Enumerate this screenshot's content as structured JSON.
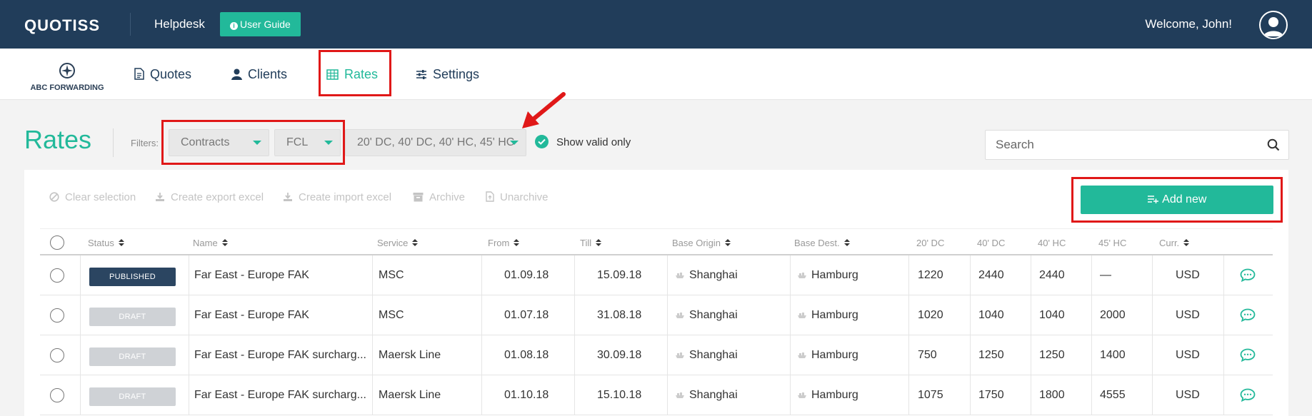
{
  "topbar": {
    "logo": "QUOTISS",
    "helpdesk": "Helpdesk",
    "user_guide": "User Guide",
    "welcome": "Welcome, John!"
  },
  "nav": {
    "brand": "ABC FORWARDING",
    "items": [
      {
        "label": "Quotes",
        "icon": "document-icon"
      },
      {
        "label": "Clients",
        "icon": "user-icon"
      },
      {
        "label": "Rates",
        "icon": "table-icon",
        "active": true
      },
      {
        "label": "Settings",
        "icon": "sliders-icon"
      }
    ]
  },
  "page": {
    "title": "Rates",
    "filters_label": "Filters:",
    "filters": [
      "Contracts",
      "FCL",
      "20' DC, 40' DC, 40' HC, 45' HC"
    ],
    "show_valid_only": "Show valid only",
    "search_placeholder": "Search"
  },
  "toolbar": {
    "clear_selection": "Clear selection",
    "create_export_excel": "Create export excel",
    "create_import_excel": "Create import excel",
    "archive": "Archive",
    "unarchive": "Unarchive",
    "add_new": "Add new"
  },
  "table": {
    "headers": [
      "Status",
      "Name",
      "Service",
      "From",
      "Till",
      "Base Origin",
      "Base Dest.",
      "20' DC",
      "40' DC",
      "40' HC",
      "45' HC",
      "Curr."
    ],
    "rows": [
      {
        "status": "PUBLISHED",
        "name": "Far East - Europe FAK",
        "service": "MSC",
        "from": "01.09.18",
        "till": "15.09.18",
        "origin": "Shanghai",
        "dest": "Hamburg",
        "dc20": "1220",
        "dc40": "2440",
        "hc40": "2440",
        "hc45": "—",
        "curr": "USD"
      },
      {
        "status": "DRAFT",
        "name": "Far East - Europe FAK",
        "service": "MSC",
        "from": "01.07.18",
        "till": "31.08.18",
        "origin": "Shanghai",
        "dest": "Hamburg",
        "dc20": "1020",
        "dc40": "1040",
        "hc40": "1040",
        "hc45": "2000",
        "curr": "USD"
      },
      {
        "status": "DRAFT",
        "name": "Far East - Europe FAK surcharg...",
        "service": "Maersk Line",
        "from": "01.08.18",
        "till": "30.09.18",
        "origin": "Shanghai",
        "dest": "Hamburg",
        "dc20": "750",
        "dc40": "1250",
        "hc40": "1250",
        "hc45": "1400",
        "curr": "USD"
      },
      {
        "status": "DRAFT",
        "name": "Far East - Europe FAK surcharg...",
        "service": "Maersk Line",
        "from": "01.10.18",
        "till": "15.10.18",
        "origin": "Shanghai",
        "dest": "Hamburg",
        "dc20": "1075",
        "dc40": "1750",
        "hc40": "1800",
        "hc45": "4555",
        "curr": "USD"
      }
    ]
  },
  "colors": {
    "navy": "#213d5a",
    "accent": "#22b99a",
    "annotation": "#e01818"
  }
}
